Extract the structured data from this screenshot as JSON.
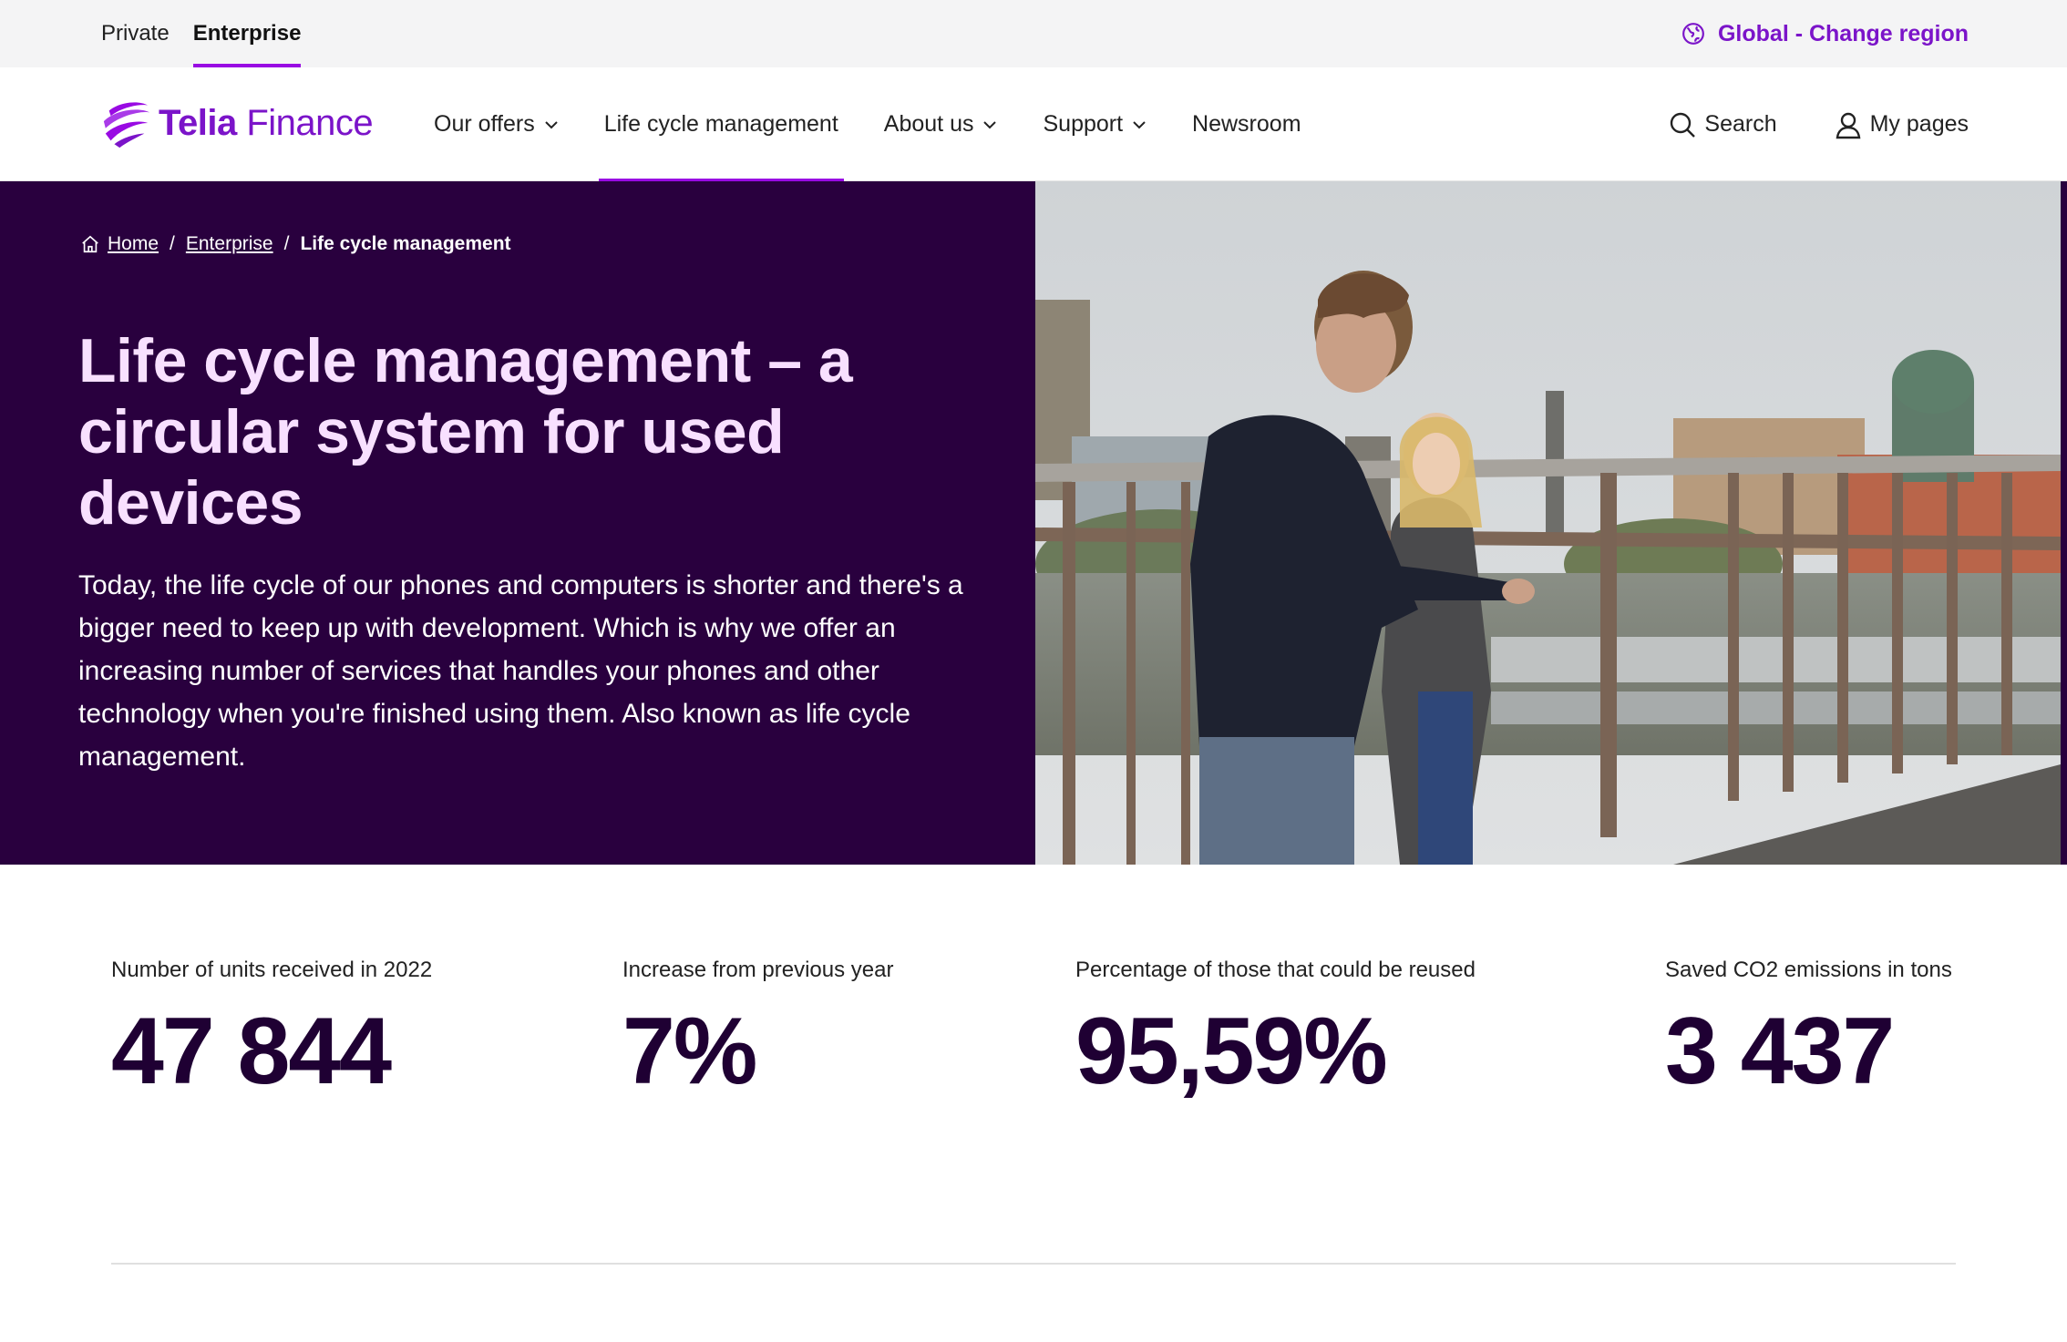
{
  "utility_bar": {
    "segments": [
      {
        "label": "Private",
        "active": false
      },
      {
        "label": "Enterprise",
        "active": true
      }
    ],
    "region_label": "Global - Change region",
    "region_icon": "globe-icon"
  },
  "header": {
    "logo": {
      "brand": "Telia",
      "product": "Finance",
      "icon": "telia-pebble-logo"
    },
    "nav": [
      {
        "label": "Our offers",
        "has_dropdown": true
      },
      {
        "label": "Life cycle management",
        "has_dropdown": false,
        "active": true
      },
      {
        "label": "About us",
        "has_dropdown": true
      },
      {
        "label": "Support",
        "has_dropdown": true
      },
      {
        "label": "Newsroom",
        "has_dropdown": false
      }
    ],
    "search_label": "Search",
    "mypages_label": "My pages"
  },
  "hero": {
    "breadcrumb": {
      "home": "Home",
      "sep": "/",
      "enterprise": "Enterprise",
      "current": "Life cycle management"
    },
    "title": "Life cycle management – a circular system for used devices",
    "text": "Today, the life cycle of our phones and computers is shorter and there's a bigger need to keep up with development. Which is why we offer an increasing number of services that handles your phones and other technology when you're finished using them. Also known as life cycle management."
  },
  "stats": [
    {
      "label": "Number of units received in 2022",
      "value": "47 844"
    },
    {
      "label": "Increase from previous year",
      "value": "7%"
    },
    {
      "label": "Percentage of those that could be reused",
      "value": "95,59%"
    },
    {
      "label": "Saved CO2 emissions in tons",
      "value": "3 437"
    }
  ],
  "colors": {
    "brand_purple": "#990ae3",
    "link_purple": "#7b14c9",
    "hero_bg": "#29003e",
    "hero_title": "#f8e0ff"
  }
}
